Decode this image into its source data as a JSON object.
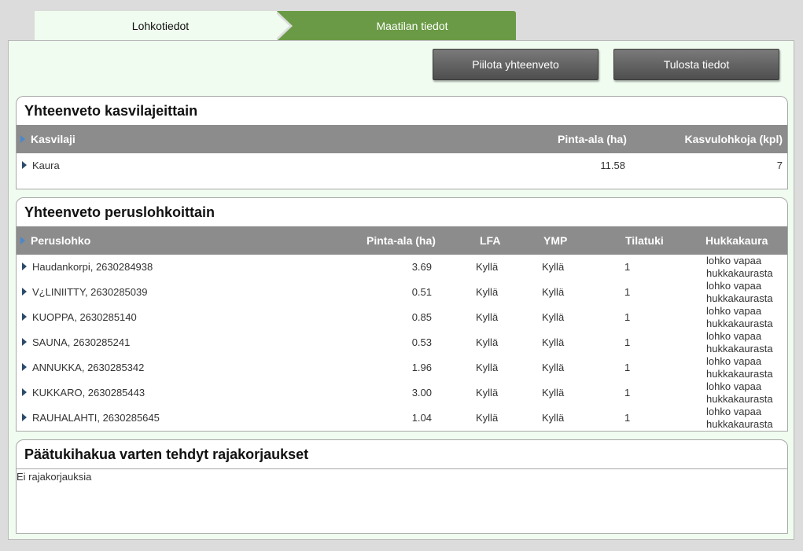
{
  "tabs": [
    {
      "label": "Lohkotiedot",
      "active": true
    },
    {
      "label": "Maatilan tiedot",
      "active": false
    }
  ],
  "toolbar": {
    "hide_summary_label": "Piilota yhteenveto",
    "print_label": "Tulosta tiedot"
  },
  "crop_summary": {
    "title": "Yhteenveto kasvilajeittain",
    "columns": [
      "Kasvilaji",
      "Pinta-ala (ha)",
      "Kasvulohkoja (kpl)"
    ],
    "rows": [
      {
        "name": "Kaura",
        "area": "11.58",
        "count": "7"
      }
    ]
  },
  "parcel_summary": {
    "title": "Yhteenveto peruslohkoittain",
    "columns": [
      "Peruslohko",
      "Pinta-ala (ha)",
      "LFA",
      "YMP",
      "Tilatuki",
      "Hukkakaura"
    ],
    "rows": [
      {
        "name": "Haudankorpi, 2630284938",
        "area": "3.69",
        "lfa": "Kyllä",
        "ymp": "Kyllä",
        "tilatuki": "1",
        "hk1": "lohko vapaa",
        "hk2": "hukkakaurasta"
      },
      {
        "name": "V¿LINIITTY, 2630285039",
        "area": "0.51",
        "lfa": "Kyllä",
        "ymp": "Kyllä",
        "tilatuki": "1",
        "hk1": "lohko vapaa",
        "hk2": "hukkakaurasta"
      },
      {
        "name": "KUOPPA, 2630285140",
        "area": "0.85",
        "lfa": "Kyllä",
        "ymp": "Kyllä",
        "tilatuki": "1",
        "hk1": "lohko vapaa",
        "hk2": "hukkakaurasta"
      },
      {
        "name": "SAUNA, 2630285241",
        "area": "0.53",
        "lfa": "Kyllä",
        "ymp": "Kyllä",
        "tilatuki": "1",
        "hk1": "lohko vapaa",
        "hk2": "hukkakaurasta"
      },
      {
        "name": "ANNUKKA, 2630285342",
        "area": "1.96",
        "lfa": "Kyllä",
        "ymp": "Kyllä",
        "tilatuki": "1",
        "hk1": "lohko vapaa",
        "hk2": "hukkakaurasta"
      },
      {
        "name": "KUKKARO, 2630285443",
        "area": "3.00",
        "lfa": "Kyllä",
        "ymp": "Kyllä",
        "tilatuki": "1",
        "hk1": "lohko vapaa",
        "hk2": "hukkakaurasta"
      },
      {
        "name": "RAUHALAHTI, 2630285645",
        "area": "1.04",
        "lfa": "Kyllä",
        "ymp": "Kyllä",
        "tilatuki": "1",
        "hk1": "lohko vapaa",
        "hk2": "hukkakaurasta"
      }
    ]
  },
  "boundary_corrections": {
    "title": "Päätukihakua varten tehdyt rajakorjaukset",
    "empty_text": "Ei rajakorjauksia"
  },
  "colors": {
    "active_tab": "#f0fcef",
    "inactive_tab": "#6a9a45",
    "header_bar": "#8c8c8c",
    "button": "#5e5e5e"
  }
}
